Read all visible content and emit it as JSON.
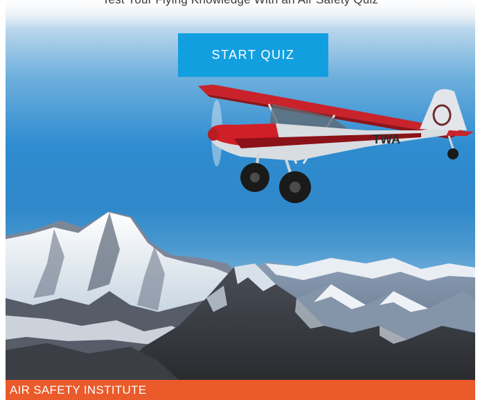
{
  "hero": {
    "subtitle": "Test Your Flying Knowledge With an Air Safety Quiz",
    "start_quiz_label": "START QUIZ",
    "plane_tail_text": "TWA"
  },
  "footer": {
    "brand": "AIR SAFETY INSTITUTE"
  },
  "colors": {
    "button": "#129fdf",
    "brand_bar": "#ea5a2a",
    "plane_red": "#d8232a"
  },
  "icons": {
    "plane": "airplane-illustration",
    "mountains": "mountain-range-illustration"
  }
}
